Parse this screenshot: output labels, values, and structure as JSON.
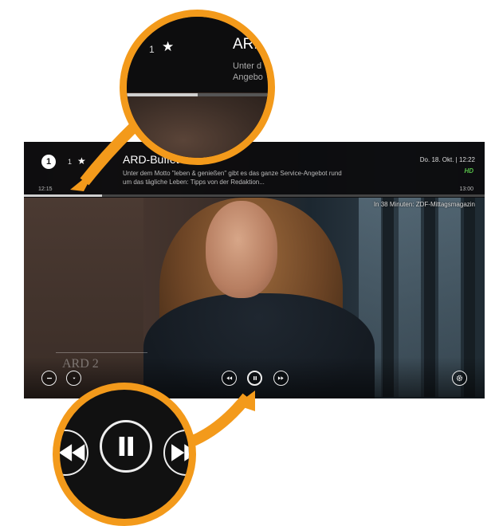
{
  "channel": {
    "logo_text": "1",
    "number": "1",
    "star_icon": "star-icon"
  },
  "program": {
    "title": "ARD-Buffet",
    "description": "Unter dem Motto \"leben & genießen\" gibt es das ganze Service-Angebot rund um das tägliche Leben: Tipps von der Redaktion...",
    "start_time": "12:15",
    "end_time": "13:00",
    "progress": 0.17
  },
  "status": {
    "datetime": "Do. 18. Okt. | 12:22",
    "hd_badge": "HD",
    "up_next": "In 38 Minuten: ZDF-Mittagsmagazin"
  },
  "watermark": {
    "text": "ARD 2"
  },
  "controls": {
    "left_icons": [
      "minus-icon",
      "chevron-down-icon"
    ],
    "center_icons": [
      "rewind-icon",
      "pause-icon",
      "fast-forward-icon"
    ],
    "right_icon": "gear-icon"
  },
  "magnifier_top": {
    "number": "1",
    "title_partial": "ARD",
    "desc_line1": "Unter d",
    "desc_line2": "Angebo",
    "progress": 0.5
  },
  "colors": {
    "accent_orange": "#f39a1b",
    "hd_green": "#58c14a"
  }
}
